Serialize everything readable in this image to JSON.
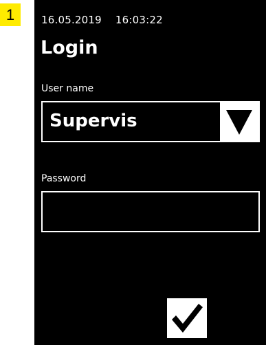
{
  "step": {
    "number": "1",
    "color": "#ffeb00"
  },
  "status": {
    "date": "16.05.2019",
    "time": "16:03:22"
  },
  "page": {
    "title": "Login"
  },
  "user": {
    "label": "User name",
    "value": "Supervis",
    "dropdown_icon": "triangle-down-icon"
  },
  "password": {
    "label": "Password",
    "value": ""
  },
  "confirm": {
    "icon": "checkmark-icon"
  },
  "colors": {
    "screen_background": "#000000",
    "foreground": "#ffffff"
  }
}
